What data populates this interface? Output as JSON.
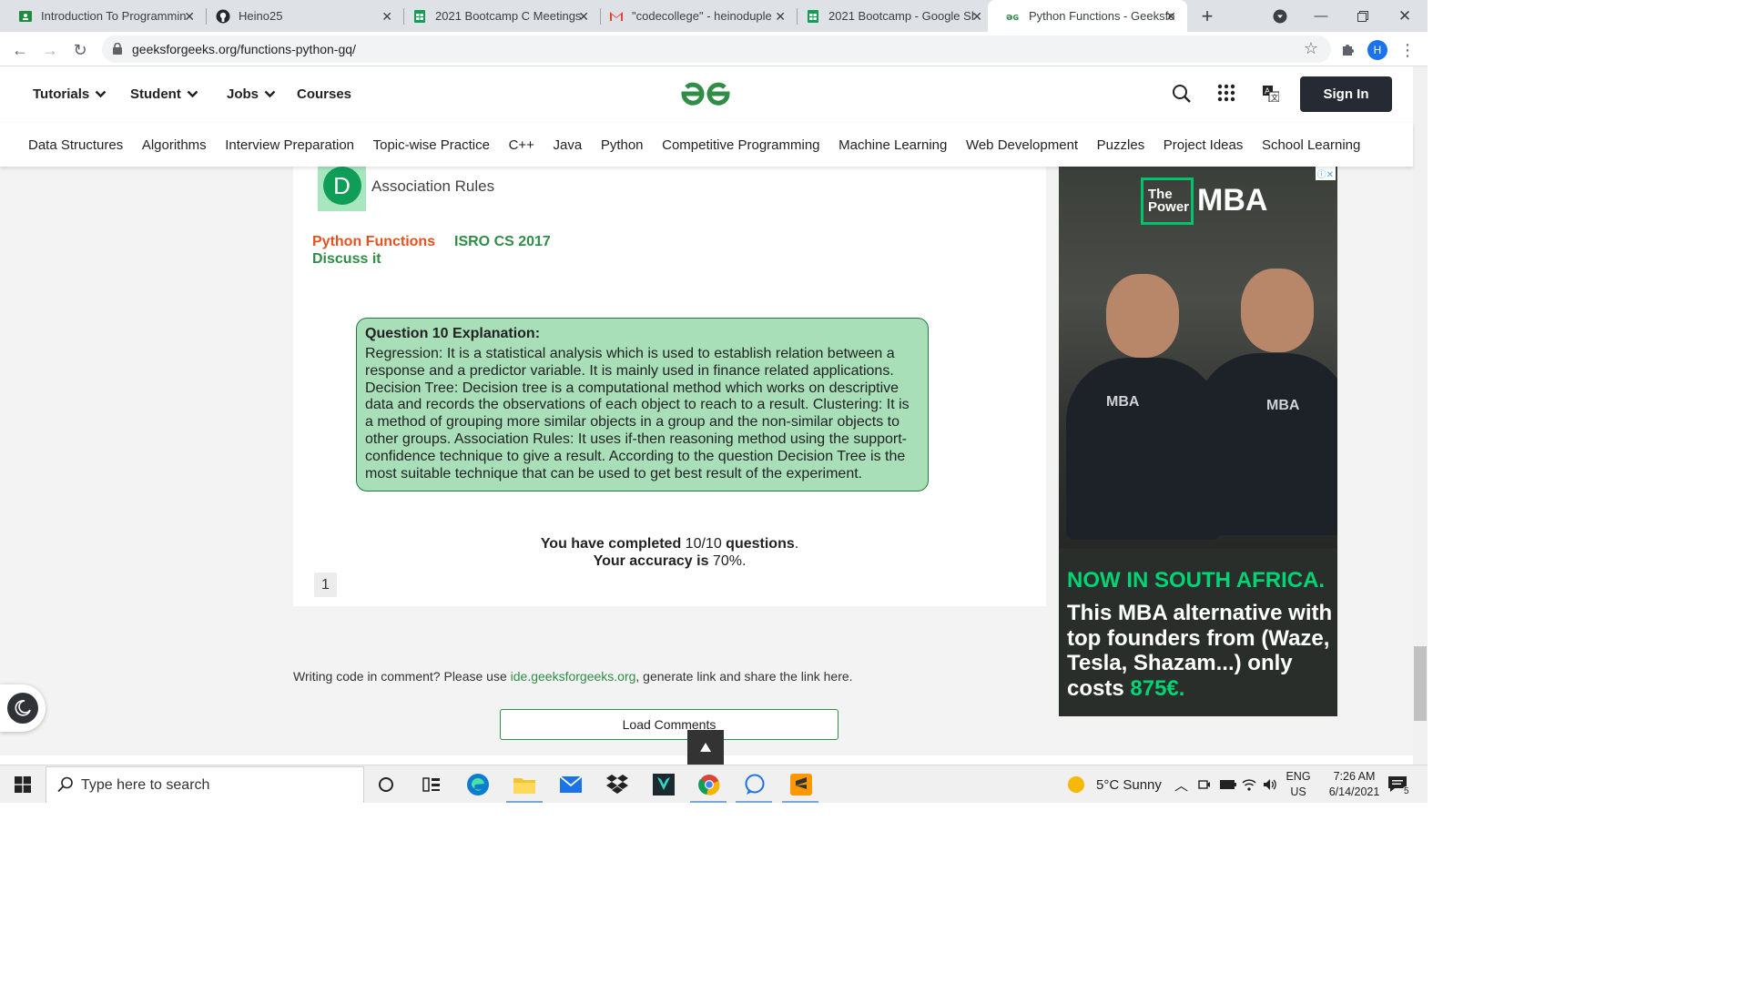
{
  "browser": {
    "tabs": [
      {
        "label": "Introduction To Programmin",
        "icon": "classroom-icon"
      },
      {
        "label": "Heino25",
        "icon": "github-icon"
      },
      {
        "label": "2021 Bootcamp C Meetings",
        "icon": "sheets-icon"
      },
      {
        "label": "\"codecollege\" - heinoduple",
        "icon": "gmail-icon"
      },
      {
        "label": "2021 Bootcamp - Google Sh",
        "icon": "sheets-icon"
      },
      {
        "label": "Python Functions - Geeksfo",
        "icon": "gfg-icon",
        "active": true
      }
    ],
    "url": "geeksforgeeks.org/functions-python-gq/",
    "profile_initial": "H"
  },
  "header": {
    "nav": [
      "Tutorials",
      "Student",
      "Jobs",
      "Courses"
    ],
    "sign_in": "Sign In",
    "categories": [
      "Data Structures",
      "Algorithms",
      "Interview Preparation",
      "Topic-wise Practice",
      "C++",
      "Java",
      "Python",
      "Competitive Programming",
      "Machine Learning",
      "Web Development",
      "Puzzles",
      "Project Ideas",
      "School Learning"
    ]
  },
  "question": {
    "option_letter": "D",
    "option_text": "Association Rules",
    "tag_primary": "Python Functions",
    "tag_secondary": "ISRO CS 2017",
    "discuss": "Discuss it",
    "explanation_title": "Question 10 Explanation:",
    "explanation_body": "Regression: It is a statistical analysis which is used to establish relation between a response and a predictor variable. It is mainly used in finance related applications. Decision Tree: Decision tree is a computational method which works on descriptive data and records the observations of each object to reach to a result. Clustering: It is a method of grouping more similar objects in a group and the non-similar objects to other groups. Association Rules: It uses if-then reasoning method using the support-confidence technique to give a result. According to the question Decision Tree is the most suitable technique that can be used to get best result of the experiment."
  },
  "result": {
    "completed_prefix": "You have completed",
    "completed_value": "10/10",
    "completed_suffix": "questions",
    "accuracy_prefix": "Your accuracy is",
    "accuracy_value": "70%",
    "page": "1"
  },
  "comments": {
    "note_prefix": "Writing code in comment? Please use",
    "note_link": "ide.geeksforgeeks.org",
    "note_suffix": ", generate link and share the link here.",
    "load_button": "Load Comments"
  },
  "ad": {
    "logo_the": "The Power",
    "logo_mba": "MBA",
    "headline": "NOW IN SOUTH AFRICA.",
    "body": "This MBA alternative with top founders from (Waze, Tesla, Shazam...) only costs",
    "price": "875€."
  },
  "taskbar": {
    "search_placeholder": "Type here to search",
    "weather": "5°C  Sunny",
    "lang_1": "ENG",
    "lang_2": "US",
    "time": "7:26 AM",
    "date": "6/14/2021",
    "notifications": "5"
  },
  "colors": {
    "gfg_green": "#2f8d46",
    "tag_orange": "#e2541f",
    "explain_bg": "#a8dfb8",
    "ad_green": "#00d474"
  }
}
